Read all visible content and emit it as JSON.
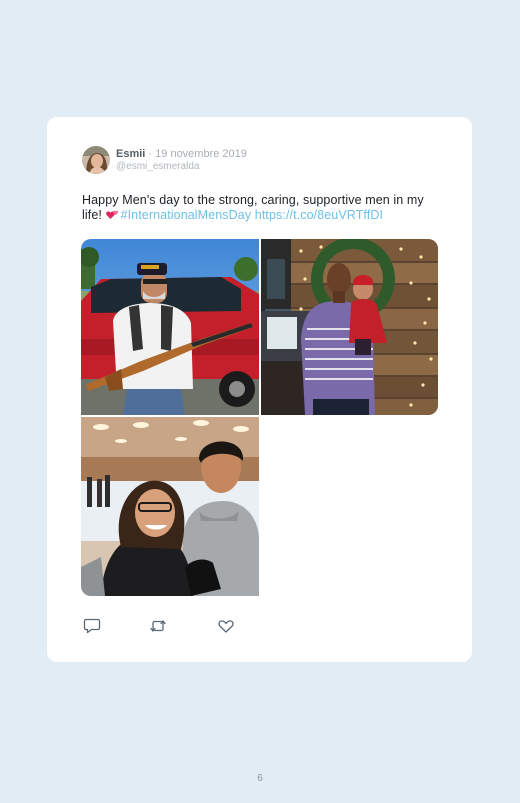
{
  "tweet": {
    "author": {
      "display_name": "Esmii",
      "separator": "·",
      "date": "19 novembre 2019",
      "handle": "@esmi_esmeralda"
    },
    "text": {
      "body": "Happy Men's day to the strong, caring, supportive men in my life! ",
      "hashtag": "#InternationalMensDay",
      "link": "https://t.co/8euVRTffDI"
    },
    "media_count": 3,
    "actions": [
      {
        "name": "reply",
        "icon": "comment-icon"
      },
      {
        "name": "retweet",
        "icon": "retweet-icon"
      },
      {
        "name": "like",
        "icon": "heart-icon"
      }
    ]
  },
  "page": {
    "number": "6"
  },
  "colors": {
    "background": "#e1ecf4",
    "card": "#ffffff",
    "link": "#6ec0e8",
    "text": "#1c2227",
    "muted": "#a6adb3",
    "emoji_heart": "#e0245e"
  }
}
